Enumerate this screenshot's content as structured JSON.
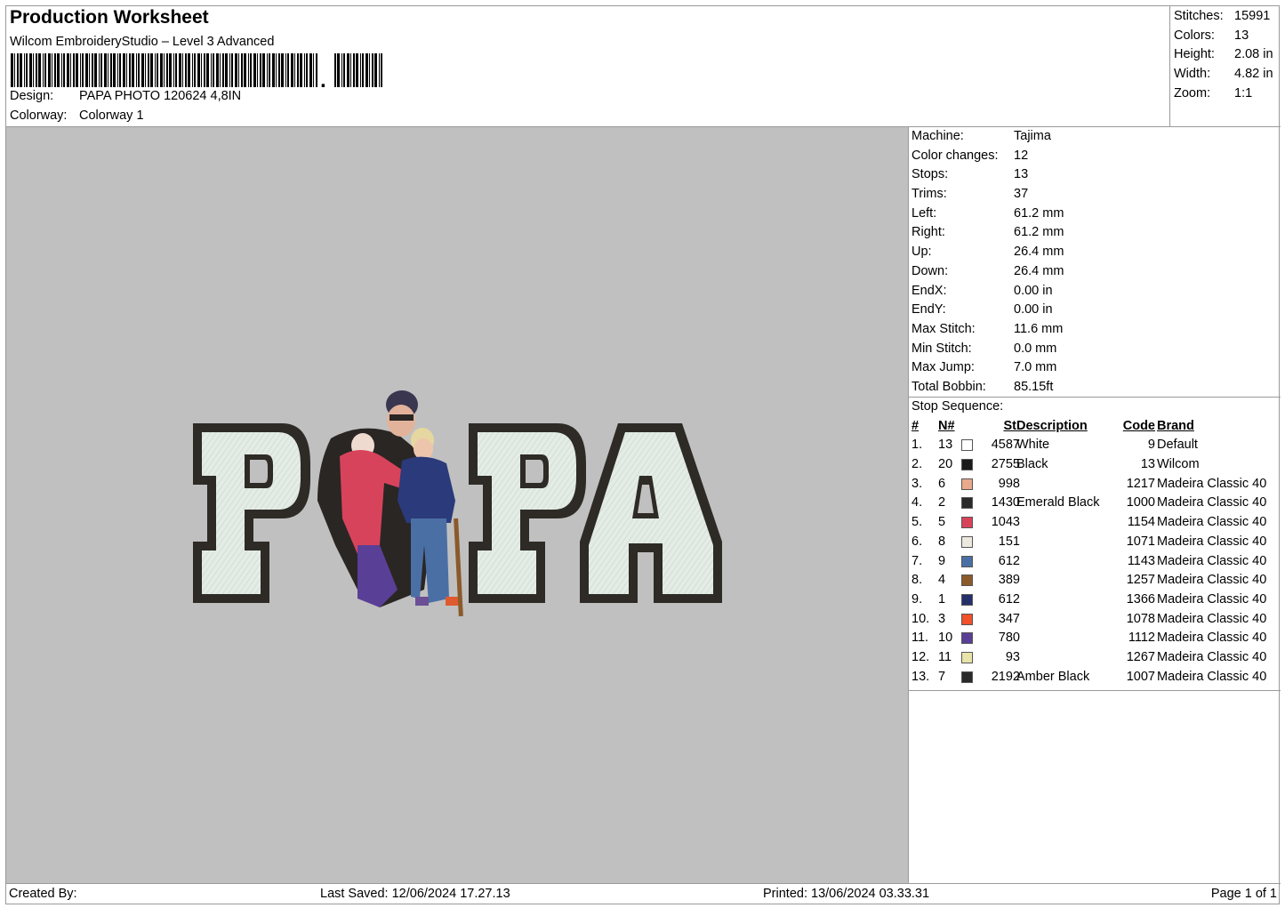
{
  "header": {
    "title": "Production Worksheet",
    "subtitle": "Wilcom EmbroideryStudio – Level 3 Advanced",
    "design_label": "Design:",
    "design_value": "PAPA PHOTO 120624 4,8IN",
    "colorway_label": "Colorway:",
    "colorway_value": "Colorway 1"
  },
  "summary": [
    {
      "label": "Stitches:",
      "value": "15991"
    },
    {
      "label": "Colors:",
      "value": "13"
    },
    {
      "label": "Height:",
      "value": "2.08 in"
    },
    {
      "label": "Width:",
      "value": "4.82 in"
    },
    {
      "label": "Zoom:",
      "value": "1:1"
    }
  ],
  "machine": [
    {
      "label": "Machine:",
      "value": "Tajima"
    },
    {
      "label": "Color changes:",
      "value": "12"
    },
    {
      "label": "Stops:",
      "value": "13"
    },
    {
      "label": "Trims:",
      "value": "37"
    },
    {
      "label": "Left:",
      "value": "61.2 mm"
    },
    {
      "label": "Right:",
      "value": "61.2 mm"
    },
    {
      "label": "Up:",
      "value": "26.4 mm"
    },
    {
      "label": "Down:",
      "value": "26.4 mm"
    },
    {
      "label": "EndX:",
      "value": "0.00 in"
    },
    {
      "label": "EndY:",
      "value": "0.00 in"
    },
    {
      "label": "Max Stitch:",
      "value": "11.6 mm"
    },
    {
      "label": "Min Stitch:",
      "value": "0.0 mm"
    },
    {
      "label": "Max Jump:",
      "value": "7.0 mm"
    },
    {
      "label": "Total Bobbin:",
      "value": "85.15ft"
    }
  ],
  "stop_sequence": {
    "title": "Stop Sequence:",
    "columns": {
      "idx": "#",
      "n": "N#",
      "st": "St.",
      "desc": "Description",
      "code": "Code",
      "brand": "Brand"
    },
    "rows": [
      {
        "idx": "1.",
        "n": "13",
        "color": "#ffffff",
        "st": "4587",
        "desc": "White",
        "code": "9",
        "brand": "Default"
      },
      {
        "idx": "2.",
        "n": "20",
        "color": "#1a1a1a",
        "st": "2755",
        "desc": "Black",
        "code": "13",
        "brand": "Wilcom"
      },
      {
        "idx": "3.",
        "n": "6",
        "color": "#e8a98c",
        "st": "998",
        "desc": "",
        "code": "1217",
        "brand": "Madeira Classic 40"
      },
      {
        "idx": "4.",
        "n": "2",
        "color": "#2a2a2a",
        "st": "1430",
        "desc": "Emerald Black",
        "code": "1000",
        "brand": "Madeira Classic 40"
      },
      {
        "idx": "5.",
        "n": "5",
        "color": "#d9435a",
        "st": "1043",
        "desc": "",
        "code": "1154",
        "brand": "Madeira Classic 40"
      },
      {
        "idx": "6.",
        "n": "8",
        "color": "#ece9df",
        "st": "151",
        "desc": "",
        "code": "1071",
        "brand": "Madeira Classic 40"
      },
      {
        "idx": "7.",
        "n": "9",
        "color": "#4a6fa5",
        "st": "612",
        "desc": "",
        "code": "1143",
        "brand": "Madeira Classic 40"
      },
      {
        "idx": "8.",
        "n": "4",
        "color": "#8b5a2b",
        "st": "389",
        "desc": "",
        "code": "1257",
        "brand": "Madeira Classic 40"
      },
      {
        "idx": "9.",
        "n": "1",
        "color": "#25306b",
        "st": "612",
        "desc": "",
        "code": "1366",
        "brand": "Madeira Classic 40"
      },
      {
        "idx": "10.",
        "n": "3",
        "color": "#f0502a",
        "st": "347",
        "desc": "",
        "code": "1078",
        "brand": "Madeira Classic 40"
      },
      {
        "idx": "11.",
        "n": "10",
        "color": "#5a3f96",
        "st": "780",
        "desc": "",
        "code": "1112",
        "brand": "Madeira Classic 40"
      },
      {
        "idx": "12.",
        "n": "11",
        "color": "#e8e3a8",
        "st": "93",
        "desc": "",
        "code": "1267",
        "brand": "Madeira Classic 40"
      },
      {
        "idx": "13.",
        "n": "7",
        "color": "#2a2a2a",
        "st": "2192",
        "desc": "Amber Black",
        "code": "1007",
        "brand": "Madeira Classic 40"
      }
    ]
  },
  "footer": {
    "created_by": "Created By:",
    "last_saved": "Last Saved: 12/06/2024 17.27.13",
    "printed": "Printed: 13/06/2024 03.33.31",
    "page": "Page 1 of 1"
  },
  "colors": {
    "preview_bg": "#c0c0c0",
    "letter_fill": "#e4ece6",
    "letter_outline": "#2e2b26"
  }
}
